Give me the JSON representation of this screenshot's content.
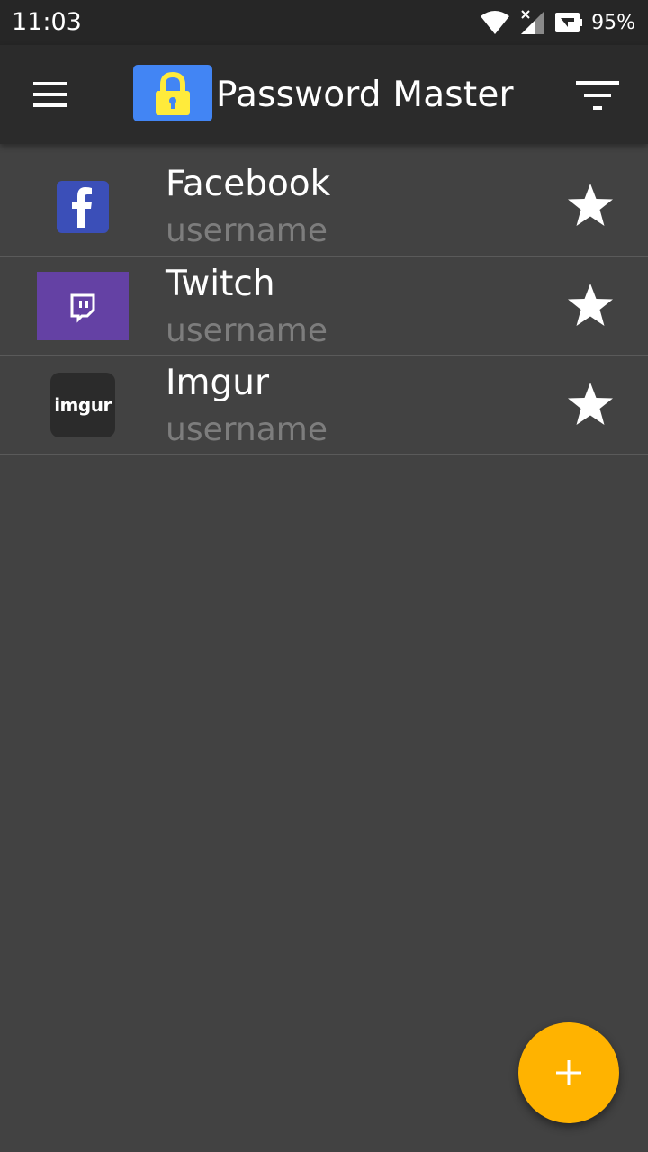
{
  "status_bar": {
    "time": "11:03",
    "battery": "95%",
    "icons": [
      "wifi-icon",
      "signal-icon",
      "battery-saver-icon"
    ]
  },
  "toolbar": {
    "title": "Password Master",
    "menu_icon": "menu-icon",
    "filter_icon": "filter-icon",
    "logo_icon": "lock-icon"
  },
  "accounts": [
    {
      "name": "Facebook",
      "username": "username",
      "icon": "facebook-logo",
      "favorite": true
    },
    {
      "name": "Twitch",
      "username": "username",
      "icon": "twitch-logo",
      "favorite": true
    },
    {
      "name": "Imgur",
      "username": "username",
      "icon": "imgur-logo",
      "logo_text": "imgur",
      "favorite": true
    }
  ],
  "fab": {
    "icon": "plus-icon"
  },
  "colors": {
    "background": "#424242",
    "toolbar": "#2b2b2b",
    "accent": "#ffb300",
    "logo_blue": "#4285f4",
    "lock_yellow": "#ffeb3b",
    "facebook": "#3b4fb8",
    "twitch": "#6441a4",
    "imgur": "#2b2b2b"
  }
}
